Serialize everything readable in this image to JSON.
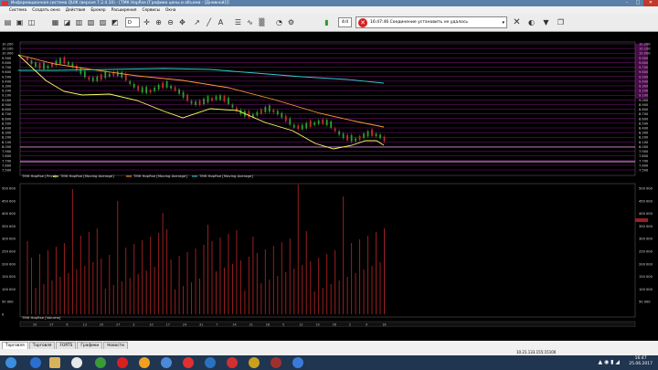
{
  "window": {
    "title": "Информационная система QUIK (версия 7.2.4.10) - [ТМК HopRse [Графики цены и объема - [Дневной]]]",
    "controls": {
      "minimize": "–",
      "maximize": "□",
      "close": "✕"
    }
  },
  "menu": [
    "Система",
    "Создать окно",
    "Действия",
    "Брокер",
    "Расширения",
    "Сервисы",
    "Окна"
  ],
  "toolbar": {
    "interval_select": "D",
    "counter": "4/4",
    "message": "16:47:46  Соединение установить не удалось",
    "icons": [
      "open-icon",
      "save-icon",
      "print-icon",
      "table-icon",
      "chart-icon",
      "orders-icon",
      "deals-icon",
      "portfolio-icon",
      "news-icon",
      "calc-icon",
      "alerts-icon",
      "settings-icon",
      "crosshair-icon",
      "zoom-in-icon",
      "zoom-out-icon",
      "move-icon",
      "cursor-icon",
      "draw-icon",
      "text-icon",
      "layers-icon",
      "indicators-icon",
      "candles-icon"
    ]
  },
  "chart": {
    "price_legend": [
      "ТМК HopRse [Price]",
      "ТМК HopRse [Moving Average]",
      "ТМК HopRse [Moving Average]",
      "ТМК HopRse [Moving Average]"
    ],
    "price_axis": [
      "10.200",
      "10.100",
      "10.000",
      "9.900",
      "9.800",
      "9.700",
      "9.600",
      "9.500",
      "9.400",
      "9.300",
      "9.200",
      "9.100",
      "9.000",
      "8.900",
      "8.800",
      "8.700",
      "8.600",
      "8.500",
      "8.400",
      "8.300",
      "8.200",
      "8.100",
      "8.000",
      "7.900",
      "7.800",
      "7.700",
      "7.600",
      "7.500"
    ],
    "volume_legend": "ТМК HopRse [Volume]",
    "volume_axis": [
      "500 000",
      "450 000",
      "400 000",
      "350 000",
      "300 000",
      "250 000",
      "200 000",
      "150 000",
      "100 000",
      "50 000",
      "0"
    ],
    "volume_right_axis": [
      "500 000",
      "450 000",
      "400 000",
      "350 000",
      "300 000",
      "250 000",
      "200 000",
      "150 000",
      "100 000",
      "50 000"
    ],
    "date_ticks": [
      "20",
      "27",
      "6",
      "13",
      "20",
      "27",
      "3",
      "10",
      "17",
      "24",
      "31",
      "7",
      "14",
      "21",
      "28",
      "5",
      "12",
      "19",
      "26",
      "2",
      "9",
      "16"
    ],
    "months": [
      "Мар",
      "Апр",
      "Май",
      "Июн"
    ],
    "colors": {
      "ma_fast": "#ffff66",
      "ma_slow": "#ff9933",
      "ma_long": "#33cccc",
      "volume": "#9a1f1f",
      "grid": "#cc22cc",
      "candle_up": "#2aa02a",
      "candle_down": "#c03030"
    }
  },
  "tabs": [
    "Торговля",
    "Торговля",
    "FORTS",
    "Графики",
    "Новости"
  ],
  "status": {
    "connection": "10.21.133.155:15100"
  },
  "taskbar": {
    "time": "16:47",
    "date": "25.06.2017"
  }
}
